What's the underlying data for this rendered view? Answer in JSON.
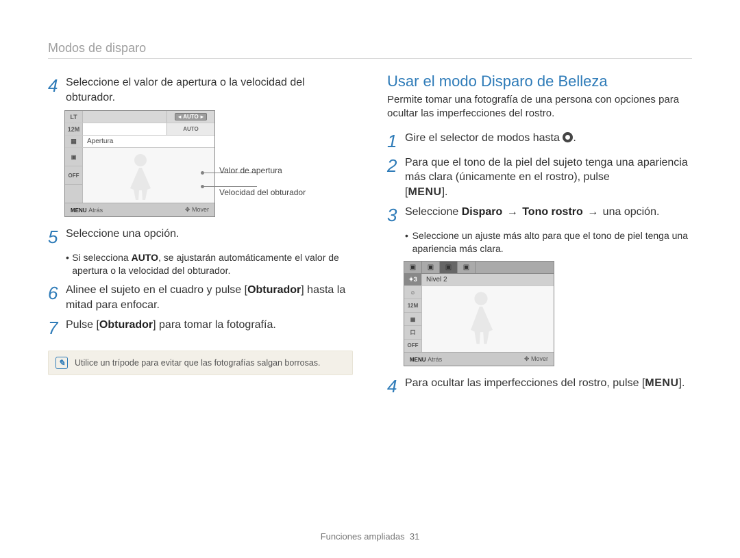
{
  "page_header": "Modos de disparo",
  "left": {
    "step4": "Seleccione el valor de apertura o la velocidad del obturador.",
    "lcd": {
      "row1_icon": "LT",
      "row1_chip": "AUTO",
      "row2_icon": "12M",
      "row2_chip": "AUTO",
      "row3_label": "Apertura",
      "side_icons": [
        "▣",
        "OFF"
      ],
      "footer_menu": "MENU",
      "footer_back": "Atrás",
      "footer_move": "Mover"
    },
    "callout1": "Valor de apertura",
    "callout2": "Velocidad del obturador",
    "step5": "Seleccione una opción.",
    "step5_bullet_pre": "Si selecciona ",
    "step5_bullet_bold": "AUTO",
    "step5_bullet_post": ", se ajustarán automáticamente el valor de apertura o la velocidad del obturador.",
    "step6_pre": "Alinee el sujeto en el cuadro y pulse [",
    "step6_bold": "Obturador",
    "step6_post": "] hasta la mitad para enfocar.",
    "step7_pre": "Pulse [",
    "step7_bold": "Obturador",
    "step7_post": "] para tomar la fotografía.",
    "note": "Utilice un trípode para evitar que las fotografías salgan borrosas."
  },
  "right": {
    "title": "Usar el modo Disparo de Belleza",
    "subtitle": "Permite tomar una fotografía de una persona con opciones para ocultar las imperfecciones del rostro.",
    "step1_pre": "Gire el selector de modos hasta ",
    "step1_post": ".",
    "step2_a": "Para que el tono de la piel del sujeto tenga una apariencia más clara (únicamente en el rostro), pulse",
    "step2_b_label": "MENU",
    "step2_b_post": ".",
    "step3_pre": "Seleccione ",
    "step3_b1": "Disparo",
    "step3_arrow": "→",
    "step3_b2": "Tono rostro",
    "step3_post": " una opción.",
    "step3_bullet": "Seleccione un ajuste más alto para que el tono de piel tenga una apariencia más clara.",
    "lcd": {
      "level": "Nivel 2",
      "side_icons": [
        "✦3",
        "☺",
        "12M",
        "▦",
        "口",
        "OFF"
      ],
      "footer_menu": "MENU",
      "footer_back": "Atrás",
      "footer_move": "Mover"
    },
    "step4_pre": "Para ocultar las imperfecciones del rostro, pulse [",
    "step4_bold": "MENU",
    "step4_post": "]."
  },
  "footer_section": "Funciones ampliadas",
  "footer_page": "31"
}
